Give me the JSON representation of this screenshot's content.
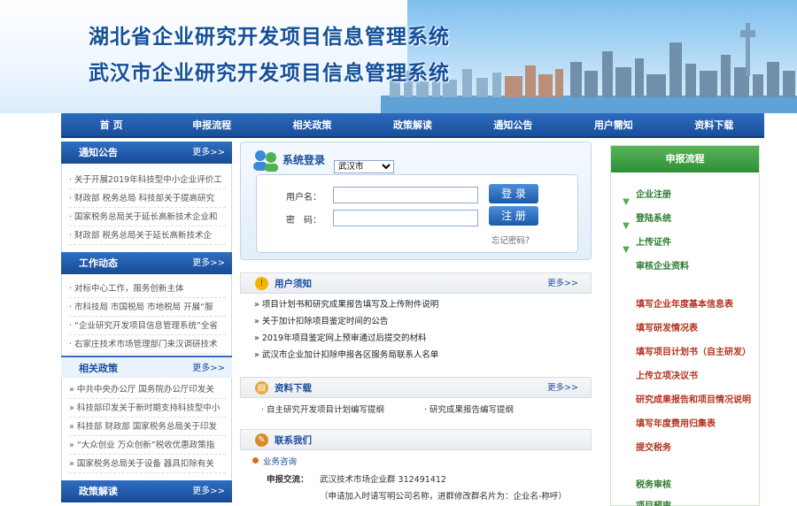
{
  "banner": {
    "title_line1": "湖北省企业研究开发项目信息管理系统",
    "title_line2": "武汉市企业研究开发项目信息管理系统"
  },
  "nav": {
    "items": [
      "首 页",
      "申报流程",
      "相关政策",
      "政策解读",
      "通知公告",
      "用户需知",
      "资料下载"
    ]
  },
  "left": {
    "notice": {
      "title": "通知公告",
      "more": "更多>>",
      "items": [
        "· 关于开展2019年科技型中小企业评价工",
        "· 财政部 税务总局 科技部关于提高研究",
        "· 国家税务总局关于延长高新技术企业和",
        "· 财政部 税务总局关于延长高新技术企"
      ]
    },
    "work": {
      "title": "工作动态",
      "more": "更多>>",
      "items": [
        "· 对标中心工作，服务创新主体",
        "· 市科技局 市国税局 市地税局 开展“服",
        "· “企业研究开发项目信息管理系统”全省",
        "· 右家庄技术市场管理部门来汉调研技术"
      ]
    },
    "policy": {
      "title": "相关政策",
      "more": "更多>>",
      "items": [
        "» 中共中央办公厅 国务院办公厅印发关",
        "» 科技部印发关于新时期支持科技型中小",
        "» 科技部 财政部 国家税务总局关于印发",
        "» “大众创业 万众创新”税收优惠政策指",
        "» 国家税务总局关于设备 器具扣除有关"
      ]
    },
    "interpret": {
      "title": "政策解读",
      "more": "更多>>"
    }
  },
  "login": {
    "title": "系统登录",
    "city": "武汉市",
    "username_label": "用户名：",
    "password_label": "密　码：",
    "login_btn": "登 录",
    "register_btn": "注 册",
    "forget": "忘记密码？"
  },
  "notice_user": {
    "title": "用户须知",
    "more": "更多>>",
    "items": [
      "» 项目计划书和研究成果报告填写及上传附件说明",
      "» 关于加计扣除项目鉴定时间的公告",
      "» 2019年项目鉴定网上预审通过后提交的材料",
      "» 武汉市企业加计扣除申报各区服务局联系人名单"
    ]
  },
  "download": {
    "title": "资料下载",
    "more": "更多>>",
    "items": [
      "· 自主研究开发项目计划编写提纲",
      "· 研究成果报告编写提纲"
    ]
  },
  "contact": {
    "title": "联系我们",
    "consult": "业务咨询",
    "label": "申报交流：",
    "value": "武汉技术市场企业群 312491412",
    "note": "（申请加入时请写明公司名称，进群修改群名片为：企业名-称呼）"
  },
  "process": {
    "title": "申报流程",
    "steps_green": [
      "企业注册",
      "登陆系统",
      "上传证件",
      "审核企业资料"
    ],
    "steps_red": [
      "填写企业年度基本信息表",
      "填写研发情况表",
      "填写项目计划书（自主研发）",
      "上传立项决议书",
      "研究成果报告和项目情况说明",
      "填写年度费用归集表",
      "提交税务"
    ],
    "tax_review": "税务审核",
    "last": "项目预审"
  }
}
